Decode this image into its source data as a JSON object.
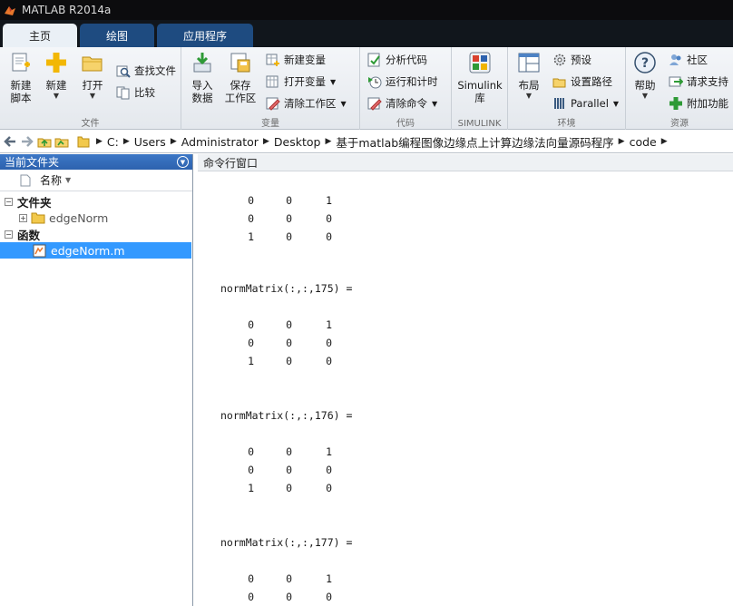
{
  "window": {
    "title": "MATLAB R2014a"
  },
  "tabs": [
    "主页",
    "绘图",
    "应用程序"
  ],
  "ribbon": {
    "file": {
      "label": "文件",
      "new_script": "新建\n脚本",
      "new": "新建",
      "open": "打开",
      "find_files": "查找文件",
      "compare": "比较"
    },
    "variable": {
      "label": "变量",
      "import": "导入\n数据",
      "save": "保存\n工作区",
      "new_var": "新建变量",
      "open_var": "打开变量",
      "clear_ws": "清除工作区"
    },
    "code": {
      "label": "代码",
      "analyze": "分析代码",
      "run_time": "运行和计时",
      "clear_cmd": "清除命令"
    },
    "simulink": {
      "label": "SIMULINK",
      "lib": "Simulink\n库"
    },
    "environment": {
      "label": "环境",
      "layout": "布局",
      "prefs": "预设",
      "set_path": "设置路径",
      "parallel": "Parallel"
    },
    "resources": {
      "label": "资源",
      "help": "帮助",
      "community": "社区",
      "support": "请求支持",
      "addons": "附加功能"
    }
  },
  "address": {
    "crumbs": [
      "C:",
      "Users",
      "Administrator",
      "Desktop",
      "基于matlab编程图像边缘点上计算边缘法向量源码程序",
      "code"
    ]
  },
  "current_folder": {
    "title": "当前文件夹",
    "column_name": "名称",
    "sections": [
      {
        "label": "文件夹",
        "items": [
          {
            "name": "edgeNorm",
            "type": "folder"
          }
        ]
      },
      {
        "label": "函数",
        "items": [
          {
            "name": "edgeNorm.m",
            "type": "mfile"
          }
        ]
      }
    ]
  },
  "command_window": {
    "title": "命令行窗口",
    "blocks": [
      {
        "header": "",
        "rows": [
          [
            0,
            0,
            1
          ],
          [
            0,
            0,
            0
          ],
          [
            1,
            0,
            0
          ]
        ]
      },
      {
        "header": "normMatrix(:,:,175) =",
        "rows": [
          [
            0,
            0,
            1
          ],
          [
            0,
            0,
            0
          ],
          [
            1,
            0,
            0
          ]
        ]
      },
      {
        "header": "normMatrix(:,:,176) =",
        "rows": [
          [
            0,
            0,
            1
          ],
          [
            0,
            0,
            0
          ],
          [
            1,
            0,
            0
          ]
        ]
      },
      {
        "header": "normMatrix(:,:,177) =",
        "rows": [
          [
            0,
            0,
            1
          ],
          [
            0,
            0,
            0
          ]
        ]
      }
    ]
  },
  "colors": {
    "titlebar": "#0c0c0e",
    "tab_inactive": "#1e4b80",
    "tab_active": "#eaf0f6",
    "panel_header": "#3c77c6",
    "selection": "#3399ff"
  }
}
